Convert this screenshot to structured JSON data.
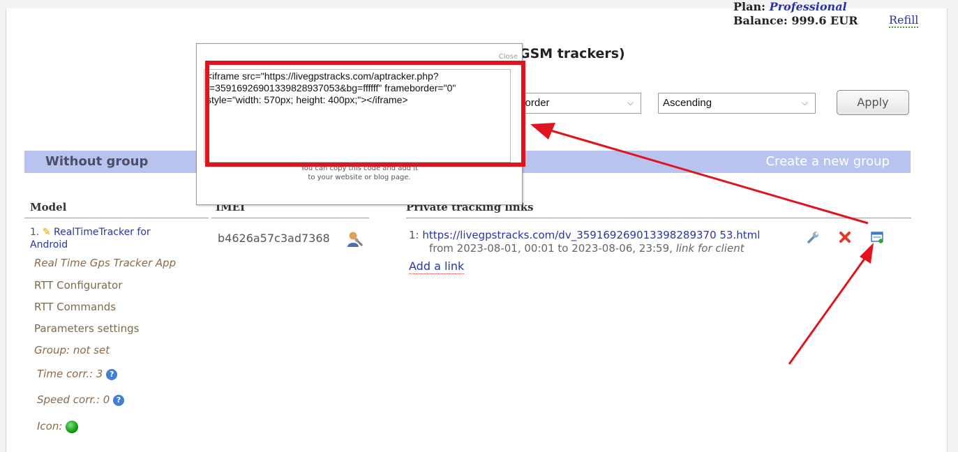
{
  "account": {
    "plan_label": "Plan:",
    "plan_value": "Professional",
    "balance_label": "Balance:",
    "balance_value": "999.6 EUR",
    "refill_label": "Refill"
  },
  "page_heading": "GSM trackers)",
  "sorting": {
    "order_by_value": "g order",
    "direction_value": "Ascending",
    "apply_label": "Apply"
  },
  "group": {
    "name": "Without group",
    "create_label": "Create a new group"
  },
  "columns": {
    "model": "Model",
    "imei": "IMEI",
    "links": "Private tracking links"
  },
  "device": {
    "index": "1.",
    "model_name": "RealTimeTracker for Android",
    "app_name": "Real Time Gps Tracker App",
    "menu": [
      "RTT Configurator",
      "RTT Commands",
      "Parameters settings"
    ],
    "group_text": "Group: not set",
    "time_corr": "Time corr.: 3",
    "speed_corr": "Speed corr.: 0",
    "icon_label": "Icon:",
    "imei": "b4626a57c3ad7368"
  },
  "tracking_link": {
    "index": "1:",
    "url": "https://livegpstracks.com/dv_359169269013398289370 53.html",
    "period": "from 2023-08-01, 00:01 to 2023-08-06, 23:59,",
    "period_note": "link for client",
    "add_link_label": "Add a link"
  },
  "popup": {
    "close_label": "Close",
    "code": "<iframe src=\"https://livegpstracks.com/aptracker.php?f=35916926901339828937053&bg=ffffff\" frameborder=\"0\" style=\"width: 570px; height: 400px;\"></iframe>",
    "note_line1": "You can copy this code and add it",
    "note_line2": "to your website or blog page."
  },
  "colors": {
    "group_bar": "#b9c3ef",
    "link_blue": "#2a33a8",
    "annotation_red": "#e0141e"
  }
}
